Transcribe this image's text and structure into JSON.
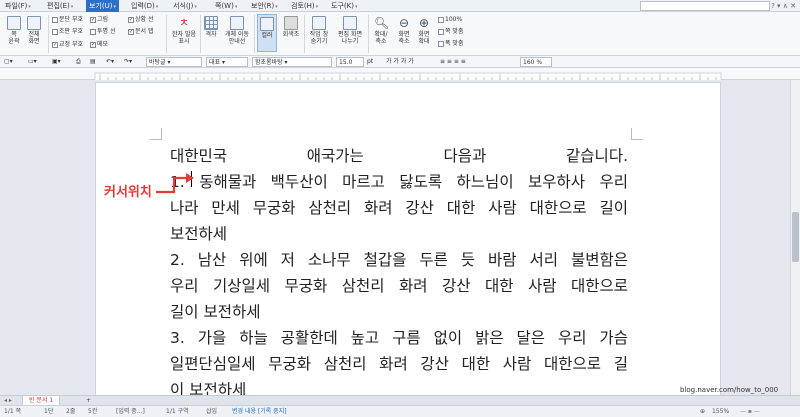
{
  "menubar": {
    "items": [
      {
        "label": "파일(F)",
        "active": false
      },
      {
        "label": "편집(E)",
        "active": false
      },
      {
        "label": "보기(U)",
        "active": true
      },
      {
        "label": "입력(D)",
        "active": false
      },
      {
        "label": "서식(J)",
        "active": false
      },
      {
        "label": "쪽(W)",
        "active": false
      },
      {
        "label": "보안(R)",
        "active": false
      },
      {
        "label": "검토(H)",
        "active": false
      },
      {
        "label": "도구(K)",
        "active": false
      }
    ]
  },
  "ribbon": {
    "page_view_label": "쪽\n윤곽",
    "full_screen_label": "전체\n화면",
    "checks": [
      {
        "label": "문단 부호",
        "checked": false
      },
      {
        "label": "그림",
        "checked": true
      },
      {
        "label": "조판 부호",
        "checked": false
      },
      {
        "label": "투명 선",
        "checked": false
      },
      {
        "label": "교정 부호",
        "checked": true
      },
      {
        "label": "메모",
        "checked": true
      },
      {
        "label": "상황 선",
        "checked": true
      },
      {
        "label": "문서 탭",
        "checked": true
      }
    ],
    "hanja_label": "한자 발음\n표시",
    "grid_label": "격자",
    "object_move_label": "개체 이동\n안내선",
    "color_label": "컬러",
    "gray_label": "회색조",
    "task_window_label": "작업 창\n숨기기",
    "edit_window_label": "편집 화면\n나누기",
    "zoom_in_out_label": "확대/\n축소",
    "fit_screen_label": "화면\n축소",
    "fit_width_label": "화면\n확대",
    "zoom_100": "100%",
    "page_fit": "쪽 맞춤",
    "width_fit": "폭 맞춤"
  },
  "toolbar": {
    "style": "바탕글",
    "font_lang": "대표",
    "font": "함초롬바탕",
    "size": "15.0",
    "size_unit": "pt",
    "format_chars": "가 가 가 가",
    "zoom": "160",
    "zoom_unit": "%"
  },
  "document": {
    "lines": [
      "대한민국 애국가는 다음과 같습니다.",
      "1. 동해물과 백두산이 마르고 닳도록 하느님이 보우하사 우리",
      "나라 만세 무궁화 삼천리 화려 강산 대한 사람 대한으로 길이",
      "보전하세",
      "2. 남산 위에 저 소나무 철갑을 두른 듯 바람 서리 불변함은",
      "우리 기상일세 무궁화 삼천리 화려 강산 대한 사람 대한으로",
      "길이 보전하세",
      "3. 가을 하늘 공활한데 높고 구름 없이 밝은 달은 우리 가슴",
      "일편단심일세 무궁화 삼천리 화려 강산 대한 사람 대한으로 길",
      "이 보전하세"
    ],
    "cursor_label": "커서위치"
  },
  "tabbar": {
    "doc_tab": "빈 문서 1",
    "add_tab": "+"
  },
  "status": {
    "page": "1/1 쪽",
    "section": "1단",
    "line": "2줄",
    "col": "5칸",
    "input_mode": "[입력 중...]",
    "section_count": "1/1 구역",
    "insert": "삽입",
    "track": "변경 내용 [기록 중지]",
    "zoom": "155%"
  },
  "watermark": "blog.naver.com/how_to_000"
}
